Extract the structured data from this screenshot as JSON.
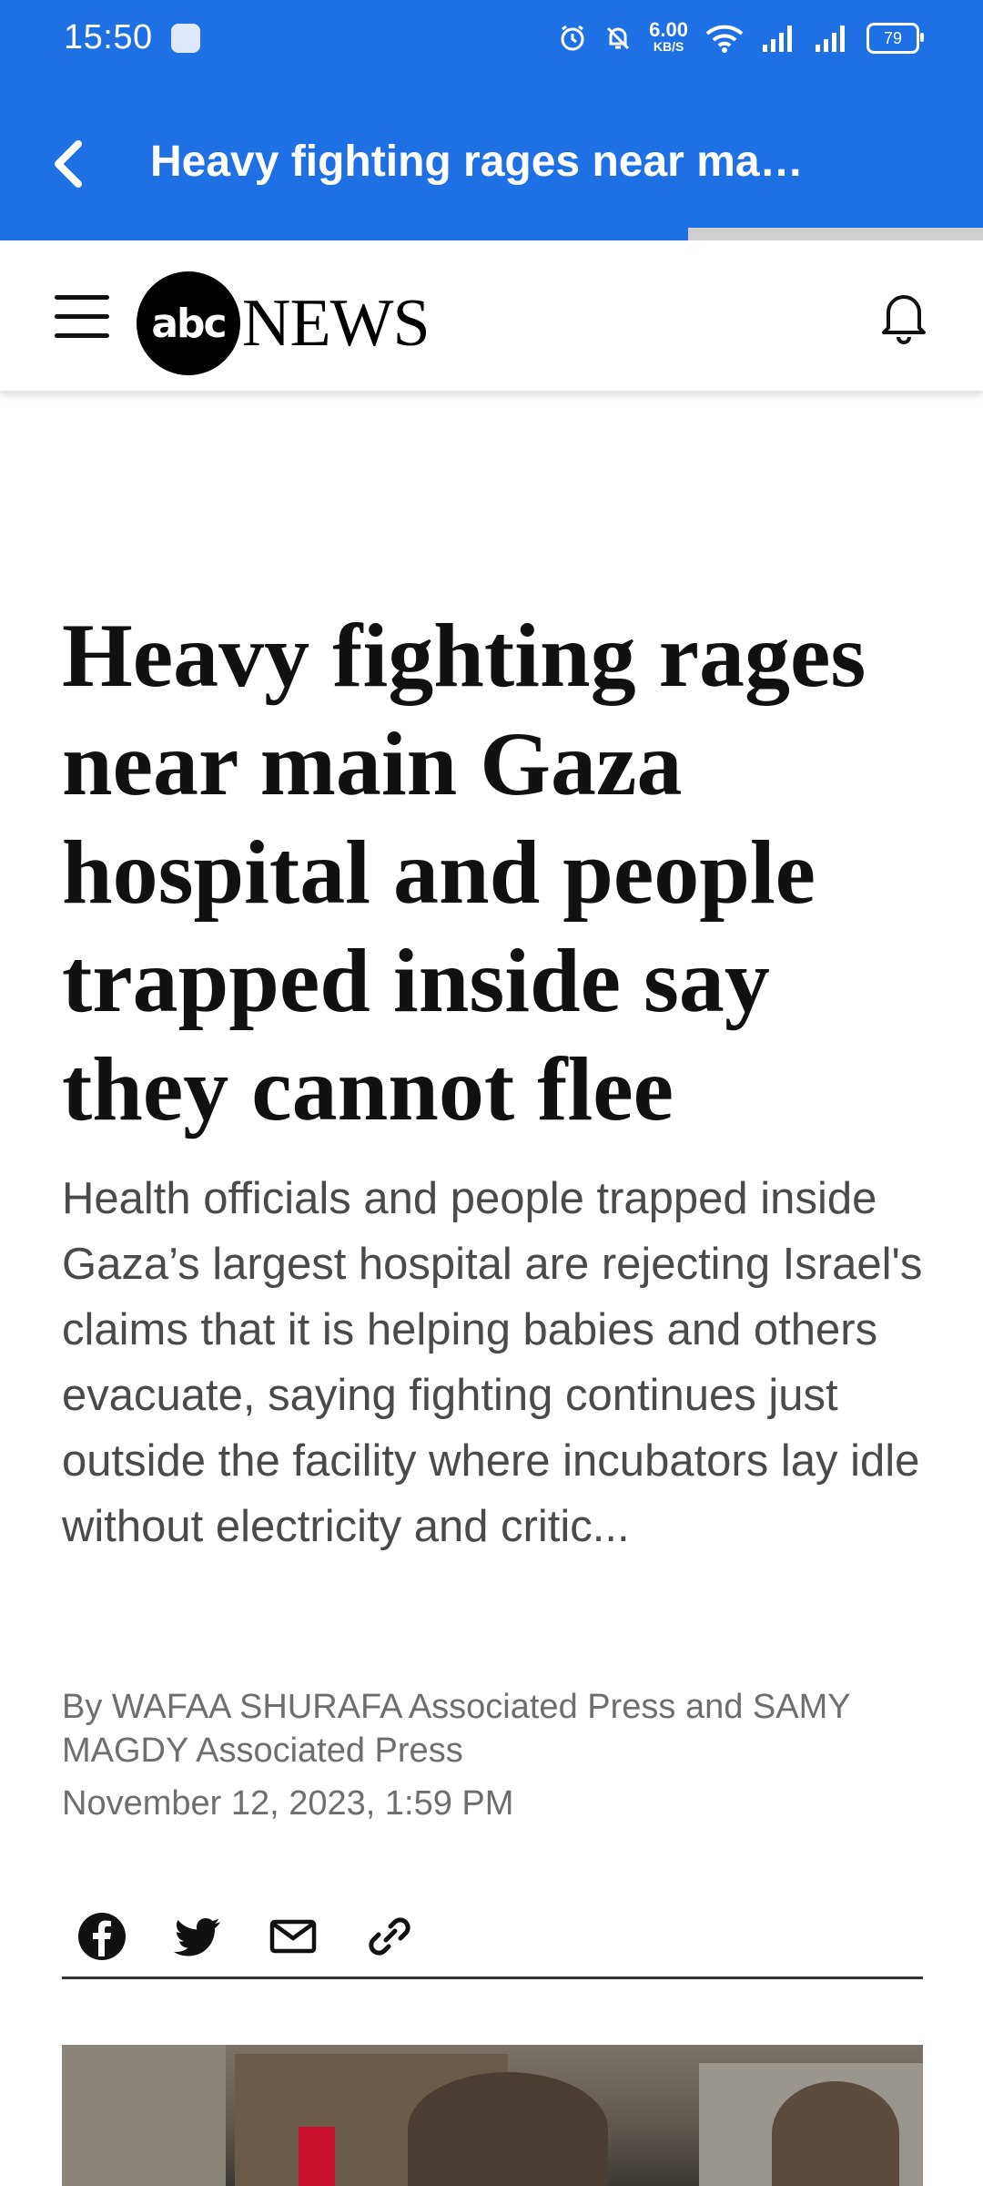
{
  "status_bar": {
    "time": "15:50",
    "network_speed": "6.00",
    "network_speed_unit": "KB/S",
    "battery": "79"
  },
  "app_bar": {
    "title": "Heavy fighting rages near ma…",
    "progress_fraction": 0.7
  },
  "site_header": {
    "logo_circle": "abc",
    "logo_word": "NEWS"
  },
  "article": {
    "headline": "Heavy fighting rages near main Gaza hospital and people trapped inside say they cannot flee",
    "summary": "Health officials and people trapped inside Gaza’s largest hospital are rejecting Israel's claims that it is helping babies and others evacuate, saying fighting continues just outside the facility where incubators lay idle without electricity and critic...",
    "byline": "By WAFAA SHURAFA Associated Press and SAMY MAGDY Associated Press",
    "date": "November 12, 2023, 1:59 PM"
  },
  "share_icons": [
    "facebook-icon",
    "twitter-icon",
    "email-icon",
    "link-icon"
  ],
  "colors": {
    "brand_blue": "#1f6fe5",
    "progress_track": "#cfcfcf"
  }
}
